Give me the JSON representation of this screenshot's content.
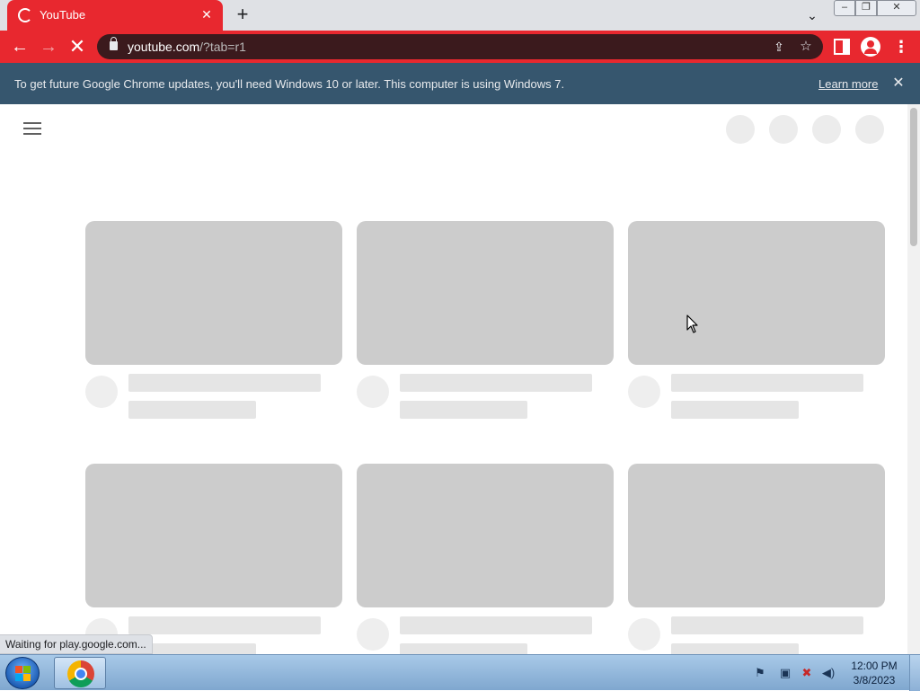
{
  "browser": {
    "tab": {
      "title": "YouTube",
      "close_glyph": "✕"
    },
    "new_tab_glyph": "+",
    "tab_search_glyph": "⌄",
    "window_controls": {
      "minimize": "–",
      "maximize": "❐",
      "close": "✕"
    },
    "toolbar": {
      "back_glyph": "←",
      "forward_glyph": "→",
      "stop_glyph": "✕",
      "url_host": "youtube.com",
      "url_path": "/?tab=r1",
      "share_glyph": "⇪",
      "star_glyph": "☆",
      "menu_glyph": "⋮"
    },
    "accent_color": "#e8282f"
  },
  "infobar": {
    "message": "To get future Google Chrome updates, you'll need Windows 10 or later. This computer is using Windows 7.",
    "learn_more": "Learn more",
    "close_glyph": "✕",
    "background": "#36566e"
  },
  "page": {
    "skeleton_rows": 2,
    "skeleton_columns": 3
  },
  "status_bar": {
    "text": "Waiting for play.google.com..."
  },
  "taskbar": {
    "clock_time": "12:00 PM",
    "clock_date": "3/8/2023",
    "tray_icons": [
      "action-center-icon",
      "network-icon",
      "flag-error-icon",
      "volume-icon"
    ]
  }
}
